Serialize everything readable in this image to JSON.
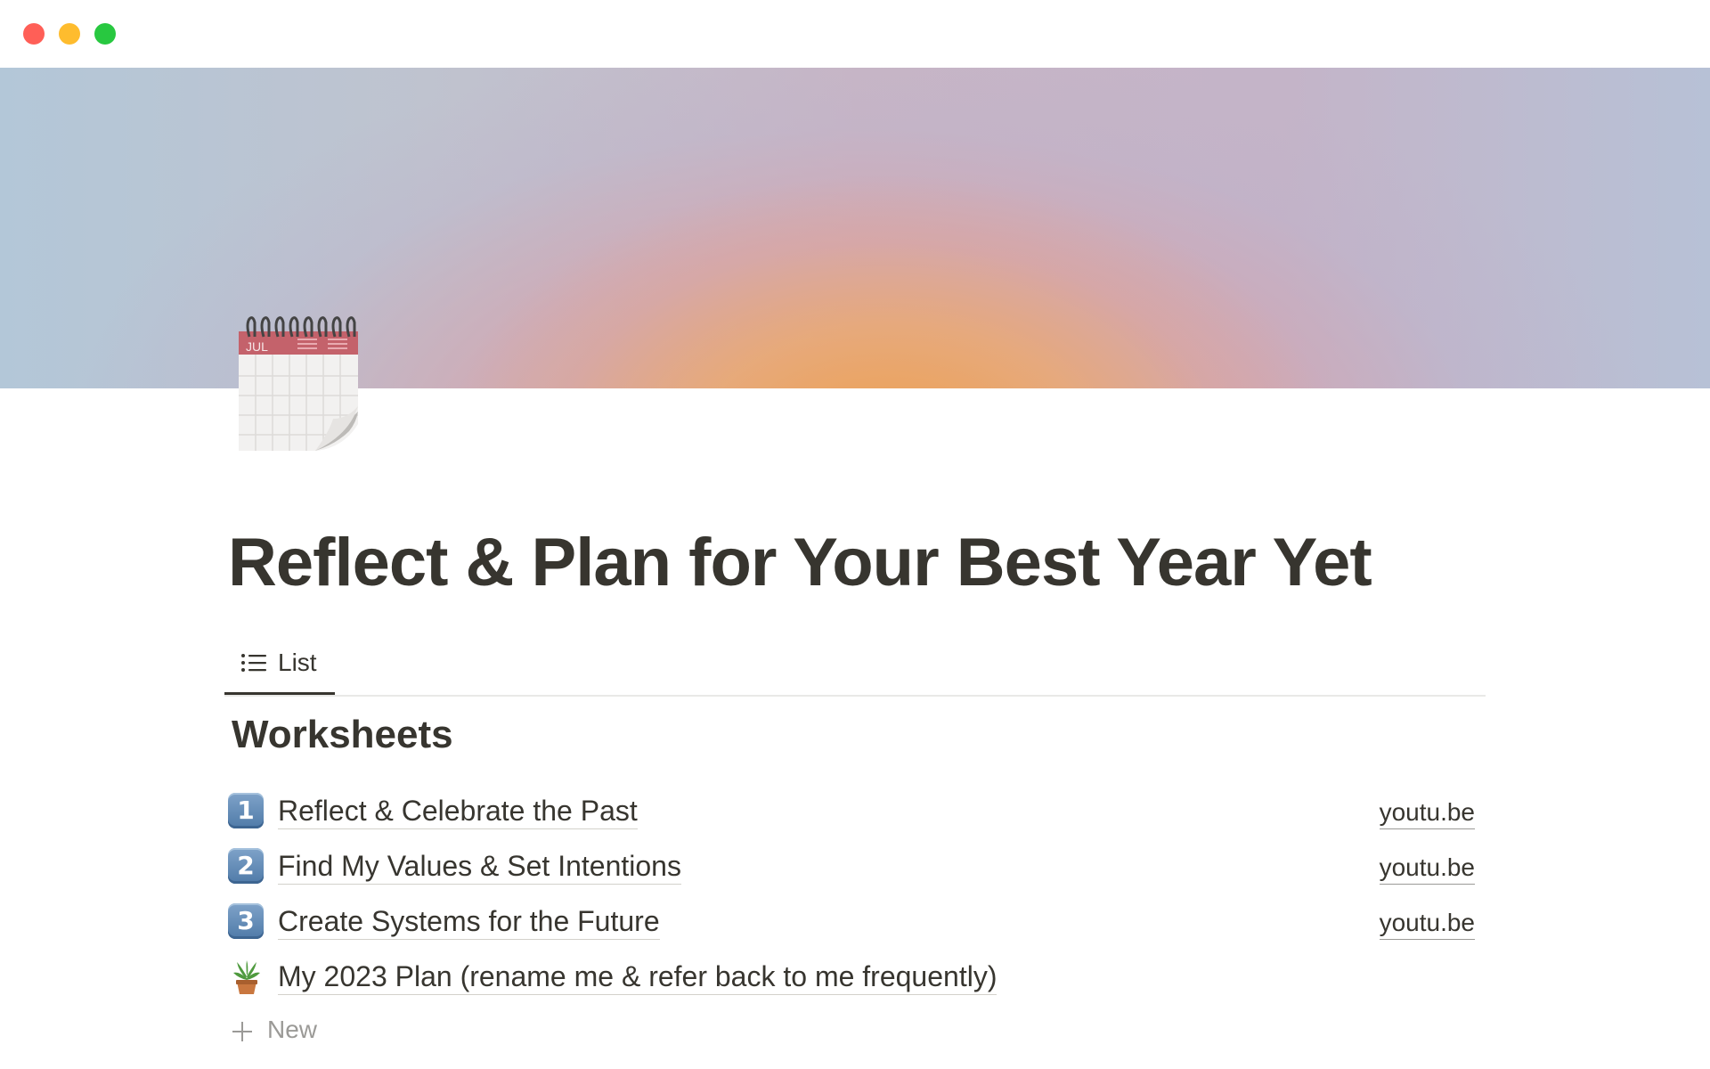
{
  "window": {
    "controls": [
      "close",
      "minimize",
      "zoom"
    ]
  },
  "cover": {
    "description": "gradient"
  },
  "page": {
    "icon": "calendar-icon",
    "calendar_month": "JUL",
    "title": "Reflect & Plan for Your Best Year Yet"
  },
  "view_tabs": [
    {
      "label": "List",
      "icon": "list-icon",
      "active": true
    }
  ],
  "section": {
    "heading": "Worksheets"
  },
  "items": [
    {
      "icon": "keycap-1-icon",
      "badge": "1",
      "title": "Reflect & Celebrate the Past",
      "link": "youtu.be"
    },
    {
      "icon": "keycap-2-icon",
      "badge": "2",
      "title": "Find My Values & Set Intentions",
      "link": "youtu.be"
    },
    {
      "icon": "keycap-3-icon",
      "badge": "3",
      "title": "Create Systems for the Future",
      "link": "youtu.be"
    },
    {
      "icon": "potted-plant-icon",
      "title": "My 2023 Plan (rename me & refer back to me frequently)"
    }
  ],
  "new_button": {
    "label": "New",
    "icon": "plus-icon"
  },
  "colors": {
    "text": "#37352f",
    "muted": "#9b9a97",
    "divider": "#e9e9e7",
    "close": "#ff5f57",
    "minimize": "#febc2e",
    "zoom": "#28c840",
    "keycap": "#5b84b1"
  }
}
